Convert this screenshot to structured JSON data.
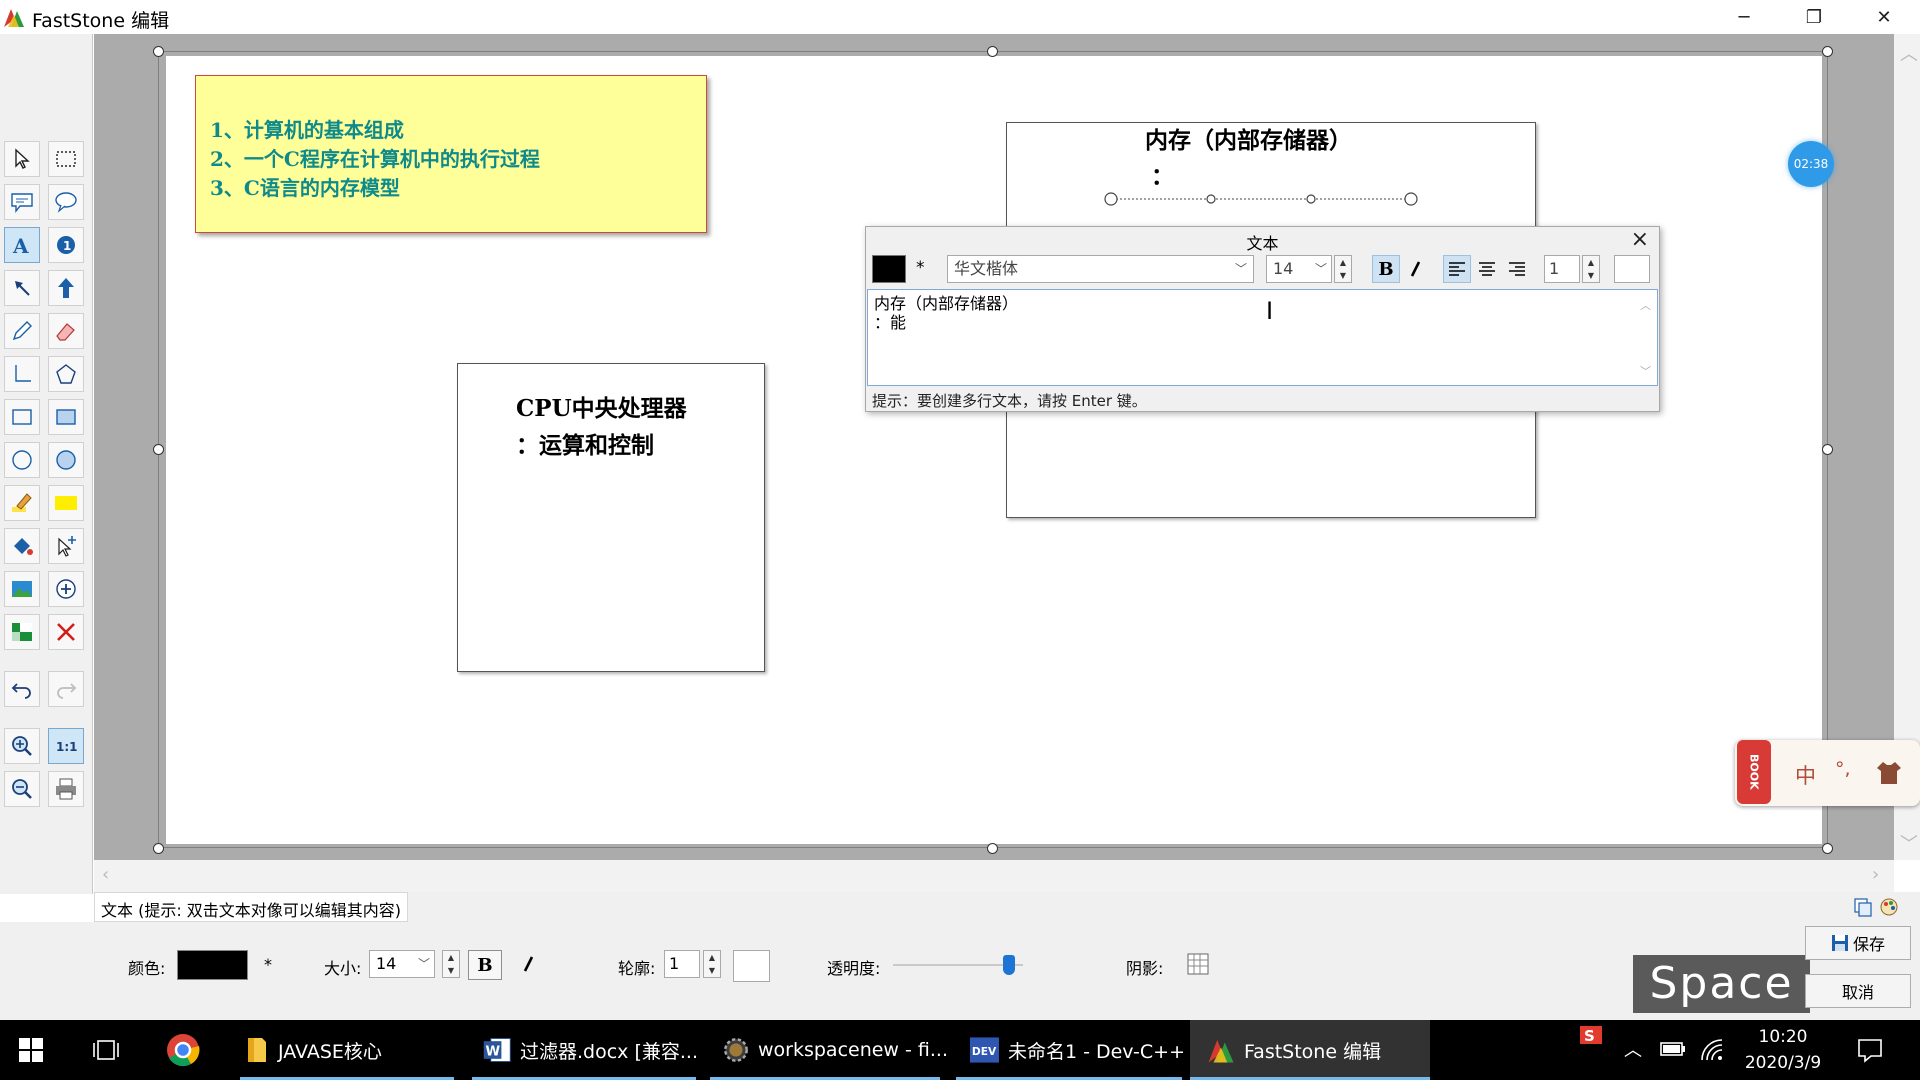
{
  "window": {
    "title": "FastStone 编辑",
    "minimize_glyph": "─",
    "restore_glyph": "❐",
    "close_glyph": "✕"
  },
  "timer": "02:38",
  "canvas": {
    "note_lines": [
      "1、计算机的基本组成",
      "2、一个C程序在计算机中的执行过程",
      "3、C语言的内存模型"
    ],
    "cpu_box_lines": [
      "CPU中央处理器",
      "：运算和控制"
    ],
    "mem_box_lines": [
      "内存（内部存储器）",
      "："
    ]
  },
  "text_panel": {
    "title": "文本",
    "font_name": "华文楷体",
    "font_size": "14",
    "line_spacing": "1",
    "asterisk": "*",
    "bold_glyph": "B",
    "editor_lines": [
      "内存（内部存储器）",
      "：能"
    ],
    "hint": "提示：要创建多行文本，请按 Enter 键。"
  },
  "status": {
    "text": "文本 (提示: 双击文本对像可以编辑其内容)"
  },
  "props": {
    "color_label": "颜色:",
    "asterisk": "*",
    "size_label": "大小:",
    "size_value": "14",
    "bold_glyph": "B",
    "outline_label": "轮廓:",
    "outline_value": "1",
    "opacity_label": "透明度:",
    "opacity_level": 0.93,
    "shadow_label": "阴影:",
    "space_badge": "Space",
    "save_label": "保存",
    "cancel_label": "取消"
  },
  "ime": {
    "book_label": "BOOK",
    "mode": "中",
    "punct": "°,"
  },
  "taskbar": {
    "items": [
      "JAVASE核心",
      "过滤器.docx [兼容...",
      "workspacenew - fi...",
      "未命名1 - Dev-C++",
      "FastStone 编辑"
    ],
    "time": "10:20",
    "date": "2020/3/9"
  },
  "colors": {
    "accent": "#2f9be8",
    "note_fill": "#ffff99",
    "note_text": "#0f8a8a",
    "canvas_bg": "#ababab"
  }
}
